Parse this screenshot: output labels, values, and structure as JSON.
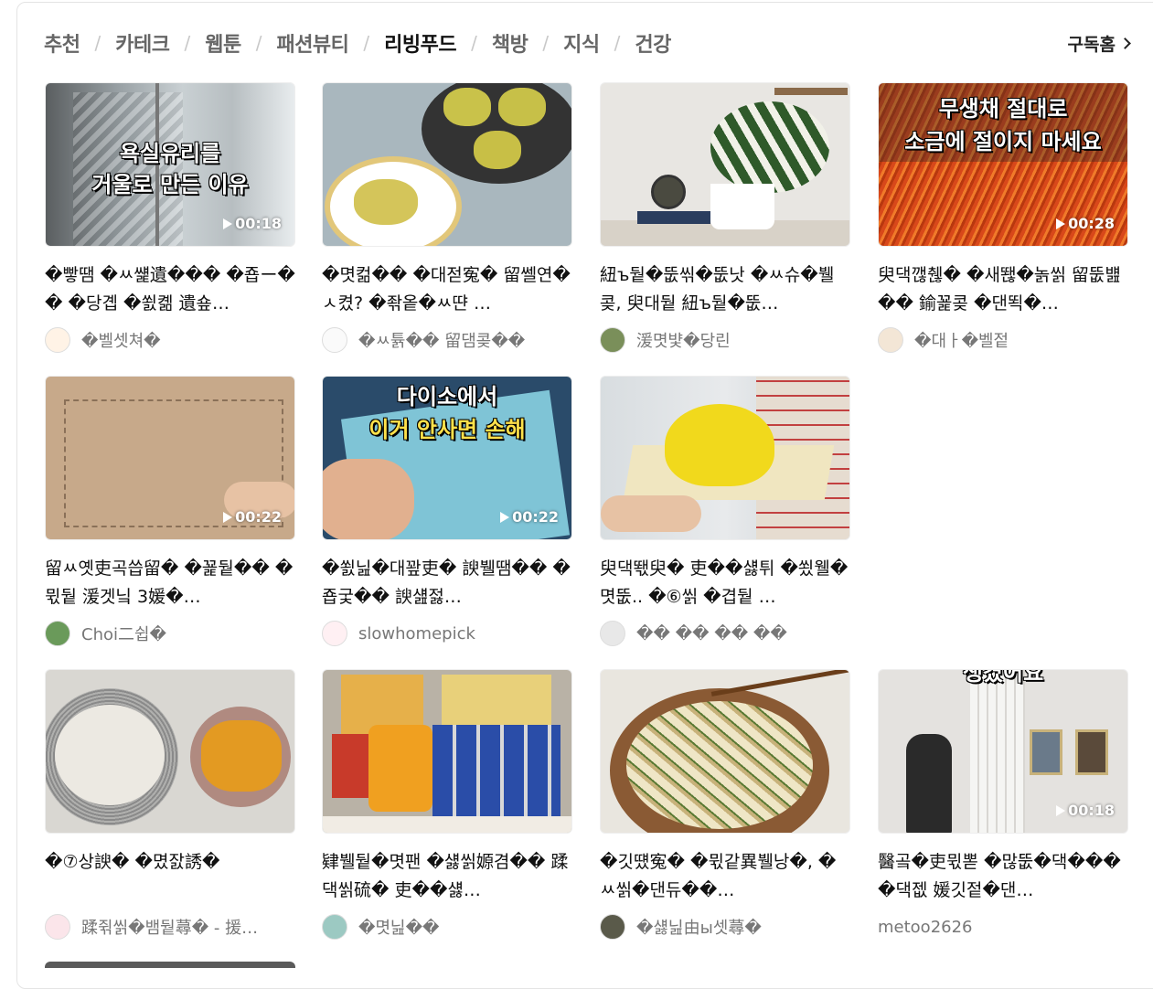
{
  "tabs": [
    "추천",
    "카테크",
    "웹툰",
    "패션뷰티",
    "리빙푸드",
    "책방",
    "지식",
    "건강"
  ],
  "active_tab": "리빙푸드",
  "subscription_home": "구독홈",
  "cards": [
    {
      "title": "�빻땜 �ㅆ썙遺��� �죱ー�� �당곕 �쐸콂 遺숖…",
      "author": "�벨셋쳐�",
      "duration": "00:18",
      "overlay": [
        "욕실유리를",
        "거울로 만든 이유"
      ]
    },
    {
      "title": "�몃컮�� �대젇寃� 留쎌연�ㅅ켰? �좎옽�ㅆ땬 …",
      "author": "�ㅆ튥�� 留댐콪��",
      "duration": "",
      "overlay": []
    },
    {
      "title": "紐ъ뒅�뚮씪�뚮낫 �ㅆ슈�뷀콪, 臾대뒅 紐ъ뒅�뚮…",
      "author": "湲몃뱣�당린",
      "duration": "",
      "overlay": []
    },
    {
      "title": "臾댁깮췒� �새뙎�놁씱 留뚮뱶�� 鍮꾩콪 �댄뙥�…",
      "author": "�대ㅏ�벨젙",
      "duration": "00:28",
      "overlay": [
        "무생채 절대로",
        "소금에 절이지 마세요"
      ]
    },
    {
      "title": "留ㅆ옛吏곡씁留� �꾩뒅�� �뮋뒅 湲겟닠 3媛�…",
      "author": "Choi二쉽�",
      "duration": "00:22",
      "overlay": []
    },
    {
      "title": "�쐸닖�대꽢吏� 諛뷀땜�� �죱궃�� 諛섎젏…",
      "author": "slowhomepick",
      "duration": "00:22",
      "overlay": [
        "다이소에서",
        "이거 안사면 손해"
      ]
    },
    {
      "title": "臾댁뙋臾� 吏��섏튀 �쑀웰�몃뚮.. �⑥씱 �겹뒅 …",
      "author": "�� �� �� ��",
      "duration": "",
      "overlay": []
    },
    {
      "title": "�⑦상諛� �몄잜誘�",
      "author": "蹂쥒씱�뱀뒅蕁� - 援…",
      "duration": "",
      "overlay": []
    },
    {
      "title": "肄뷀뒅�몃팬 �섏씱嫄겸�� 蹂댁씱硫� 吏��섏…",
      "author": "�몃닖��",
      "duration": "",
      "overlay": []
    },
    {
      "title": "�깃떘寃� �뮋같異뷀낭�, �ㅆ씱�댄듀��…",
      "author": "�섏닖由ы셋蕁�",
      "duration": "",
      "overlay": []
    },
    {
      "title": "醫곸�吏뮋뽇 �많뚮�댁��� �댁젮 媛깃젙�댄…",
      "author": "metoo2626",
      "duration": "00:18",
      "overlay": [
        "생겼어요"
      ]
    }
  ]
}
